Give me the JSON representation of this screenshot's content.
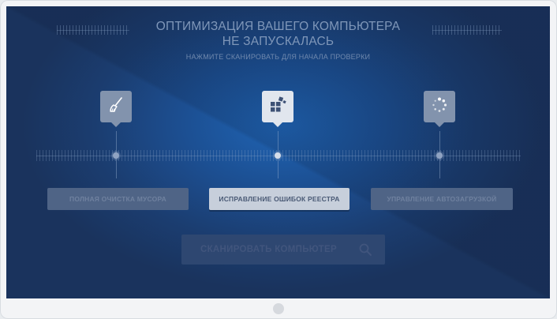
{
  "header": {
    "title_line1": "ОПТИМИЗАЦИЯ ВАШЕГО КОМПЬЮТЕРА",
    "title_line2": "НЕ ЗАПУСКАЛАСЬ",
    "subtitle": "НАЖМИТЕ СКАНИРОВАТЬ ДЛЯ НАЧАЛА ПРОВЕРКИ"
  },
  "features": [
    {
      "label": "ПОЛНАЯ ОЧИСТКА МУСОРА",
      "icon": "broom-icon",
      "active": false
    },
    {
      "label": "ИСПРАВЛЕНИЕ ОШИБОК РЕЕСТРА",
      "icon": "registry-blocks-icon",
      "active": true
    },
    {
      "label": "УПРАВЛЕНИЕ АВТОЗАГРУЗКОЙ",
      "icon": "loading-spinner-icon",
      "active": false
    }
  ],
  "scan_button": {
    "label": "СКАНИРОВАТЬ КОМПЬЮТЕР",
    "icon": "search-icon"
  },
  "colors": {
    "background": "#1c4f92",
    "text_muted": "#7f97b9",
    "active_card": "#e1e6ee"
  }
}
